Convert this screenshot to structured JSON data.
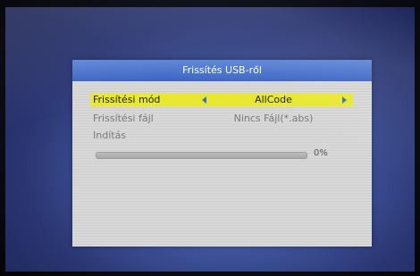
{
  "dialog": {
    "title": "Frissítés USB-ről"
  },
  "rows": [
    {
      "label": "Frissítési mód",
      "value": "AllCode",
      "selected": true
    },
    {
      "label": "Frissítési fájl",
      "value": "Nincs Fájl(*.abs)"
    },
    {
      "label": "Indítás"
    }
  ],
  "progress": {
    "percent_label": "0%",
    "value": 0
  },
  "colors": {
    "title_bar": "#4a73cc",
    "highlight": "#e8e832",
    "arrow": "#3d6fd0"
  },
  "icons": {
    "left_arrow": "triangle-left",
    "right_arrow": "triangle-right"
  }
}
